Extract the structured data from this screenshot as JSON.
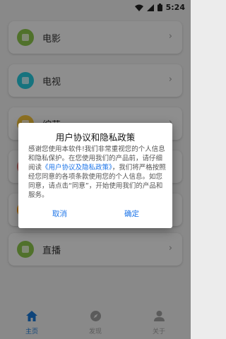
{
  "status_bar": {
    "time": "5:24",
    "wifi_icon": "wifi-icon",
    "signal_icon": "cell-signal-icon",
    "battery_icon": "battery-icon"
  },
  "menu": {
    "items": [
      {
        "label": "电影",
        "icon": "film-icon",
        "color": "#8bc34a"
      },
      {
        "label": "电视",
        "icon": "tv-icon",
        "color": "#26c6da"
      },
      {
        "label": "综艺",
        "icon": "variety-icon",
        "color": "#f2c23c"
      },
      {
        "label": "",
        "icon": "category-icon",
        "color": "#e57373"
      },
      {
        "label": "",
        "icon": "category-icon",
        "color": "#ff9800"
      },
      {
        "label": "直播",
        "icon": "live-icon",
        "color": "#8bc34a"
      }
    ],
    "arrow": "›"
  },
  "bottom_nav": {
    "active_color": "#1976d2",
    "inactive_color": "#9e9e9e",
    "items": [
      {
        "label": "主页",
        "icon": "home-icon",
        "active": true
      },
      {
        "label": "发现",
        "icon": "compass-icon",
        "active": false
      },
      {
        "label": "关于",
        "icon": "person-icon",
        "active": false
      }
    ]
  },
  "dialog": {
    "title": "用户协议和隐私政策",
    "body_intro": "感谢您使用本软件!我们非常重视您的个人信息和隐私保护。在您使用我们的产品前，请仔细阅读",
    "body_link": "《用户协议及隐私政策》",
    "body_outro": "，我们将严格按照经您同意的各项条款使用您的个人信息。如您同意，请点击“同意”，开始使用我们的产品和服务。",
    "cancel_label": "取消",
    "confirm_label": "确定",
    "accent_color": "#1a73e8"
  }
}
